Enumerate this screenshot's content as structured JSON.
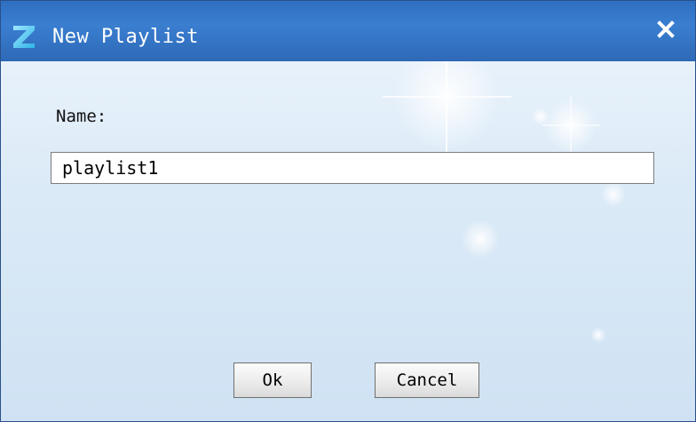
{
  "window": {
    "title": "New Playlist",
    "app_icon": "app-logo-icon",
    "close_icon": "close-icon"
  },
  "form": {
    "name_label": "Name:",
    "name_value": "playlist1"
  },
  "buttons": {
    "ok_label": "Ok",
    "cancel_label": "Cancel"
  },
  "colors": {
    "titlebar": "#3a7ed0",
    "body_background": "#dbeaf7",
    "border": "#2a4f8a"
  }
}
